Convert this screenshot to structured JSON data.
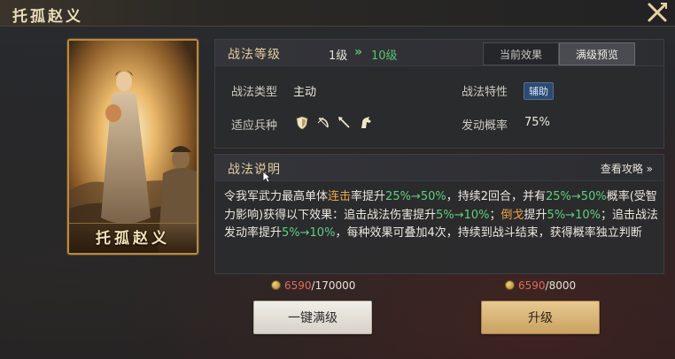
{
  "window": {
    "title": "托孤赵义"
  },
  "portrait": {
    "caption": "托孤赵义"
  },
  "level_panel": {
    "title": "战法等级",
    "level_from": "1级",
    "level_arrow": "»",
    "level_to": "10级",
    "tabs": [
      {
        "label": "当前效果",
        "active": false
      },
      {
        "label": "满级预览",
        "active": true
      }
    ],
    "type_label": "战法类型",
    "type_value": "主动",
    "trait_label": "战法特性",
    "trait_value": "辅助",
    "troops_label": "适应兵种",
    "troop_icons": [
      "shield-icon",
      "bow-icon",
      "spear-icon",
      "horse-icon"
    ],
    "chance_label": "发动概率",
    "chance_value": "75%"
  },
  "desc_panel": {
    "title": "战法说明",
    "guide_link": "查看攻略 »",
    "description": [
      {
        "text": "令我军武力最高单体",
        "style": "plain"
      },
      {
        "text": "连击",
        "style": "gold"
      },
      {
        "text": "率提升",
        "style": "plain"
      },
      {
        "text": "25%→50%",
        "style": "green"
      },
      {
        "text": "，持续2回合，并有",
        "style": "plain"
      },
      {
        "text": "25%→50%",
        "style": "green"
      },
      {
        "text": "概率(受智力影响)获得以下效果：追击战法伤害提升",
        "style": "plain"
      },
      {
        "text": "5%→10%",
        "style": "green"
      },
      {
        "text": "；",
        "style": "plain"
      },
      {
        "text": "倒戈",
        "style": "gold"
      },
      {
        "text": "提升",
        "style": "plain"
      },
      {
        "text": "5%→10%",
        "style": "green"
      },
      {
        "text": "；追击战法发动率提升",
        "style": "plain"
      },
      {
        "text": "5%→10%",
        "style": "green"
      },
      {
        "text": "，每种效果可叠加4次，持续到战斗结束，获得概率独立判断",
        "style": "plain"
      }
    ]
  },
  "costs": {
    "max_cost_current": "6590",
    "max_cost_total": "/170000",
    "up_cost_current": "6590",
    "up_cost_total": "/8000"
  },
  "buttons": {
    "max_label": "一键满级",
    "upgrade_label": "升级"
  },
  "colors": {
    "accent_gold": "#e8a64b",
    "accent_green": "#5fcf7d",
    "cost_red": "#e06a5b"
  }
}
